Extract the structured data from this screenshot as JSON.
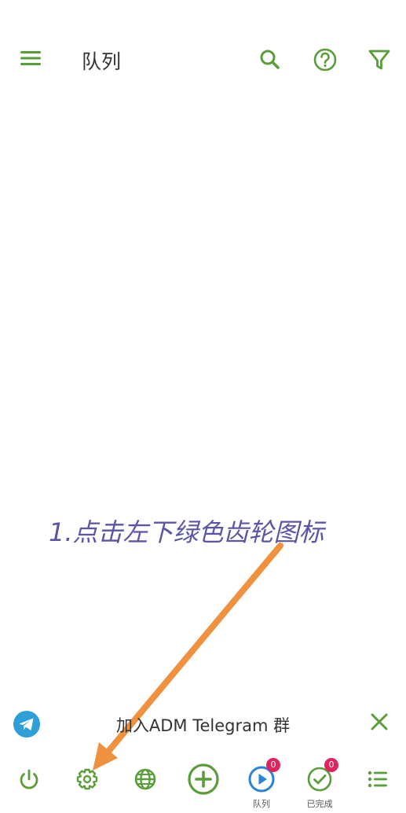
{
  "colors": {
    "accent": "#5a9e3a",
    "annotation": "#5b55a6",
    "arrow": "#f0913f",
    "badge": "#e0245e",
    "telegram": "#2f9fd8",
    "play": "#2a82d9"
  },
  "header": {
    "title": "队列",
    "menu_icon": "hamburger-menu-icon",
    "search_icon": "search-icon",
    "help_icon": "help-circle-icon",
    "filter_icon": "filter-icon"
  },
  "annotation": {
    "text": "1.点击左下绿色齿轮图标"
  },
  "banner": {
    "text": "加入ADM Telegram 群",
    "logo_icon": "telegram-icon",
    "close_icon": "close-icon"
  },
  "bottom_nav": {
    "items": [
      {
        "icon": "power-icon",
        "label": ""
      },
      {
        "icon": "gear-icon",
        "label": ""
      },
      {
        "icon": "globe-icon",
        "label": ""
      },
      {
        "icon": "add-circle-icon",
        "label": ""
      },
      {
        "icon": "play-circle-icon",
        "label": "队列",
        "badge": "0"
      },
      {
        "icon": "check-circle-icon",
        "label": "已完成",
        "badge": "0"
      },
      {
        "icon": "list-icon",
        "label": ""
      }
    ]
  }
}
